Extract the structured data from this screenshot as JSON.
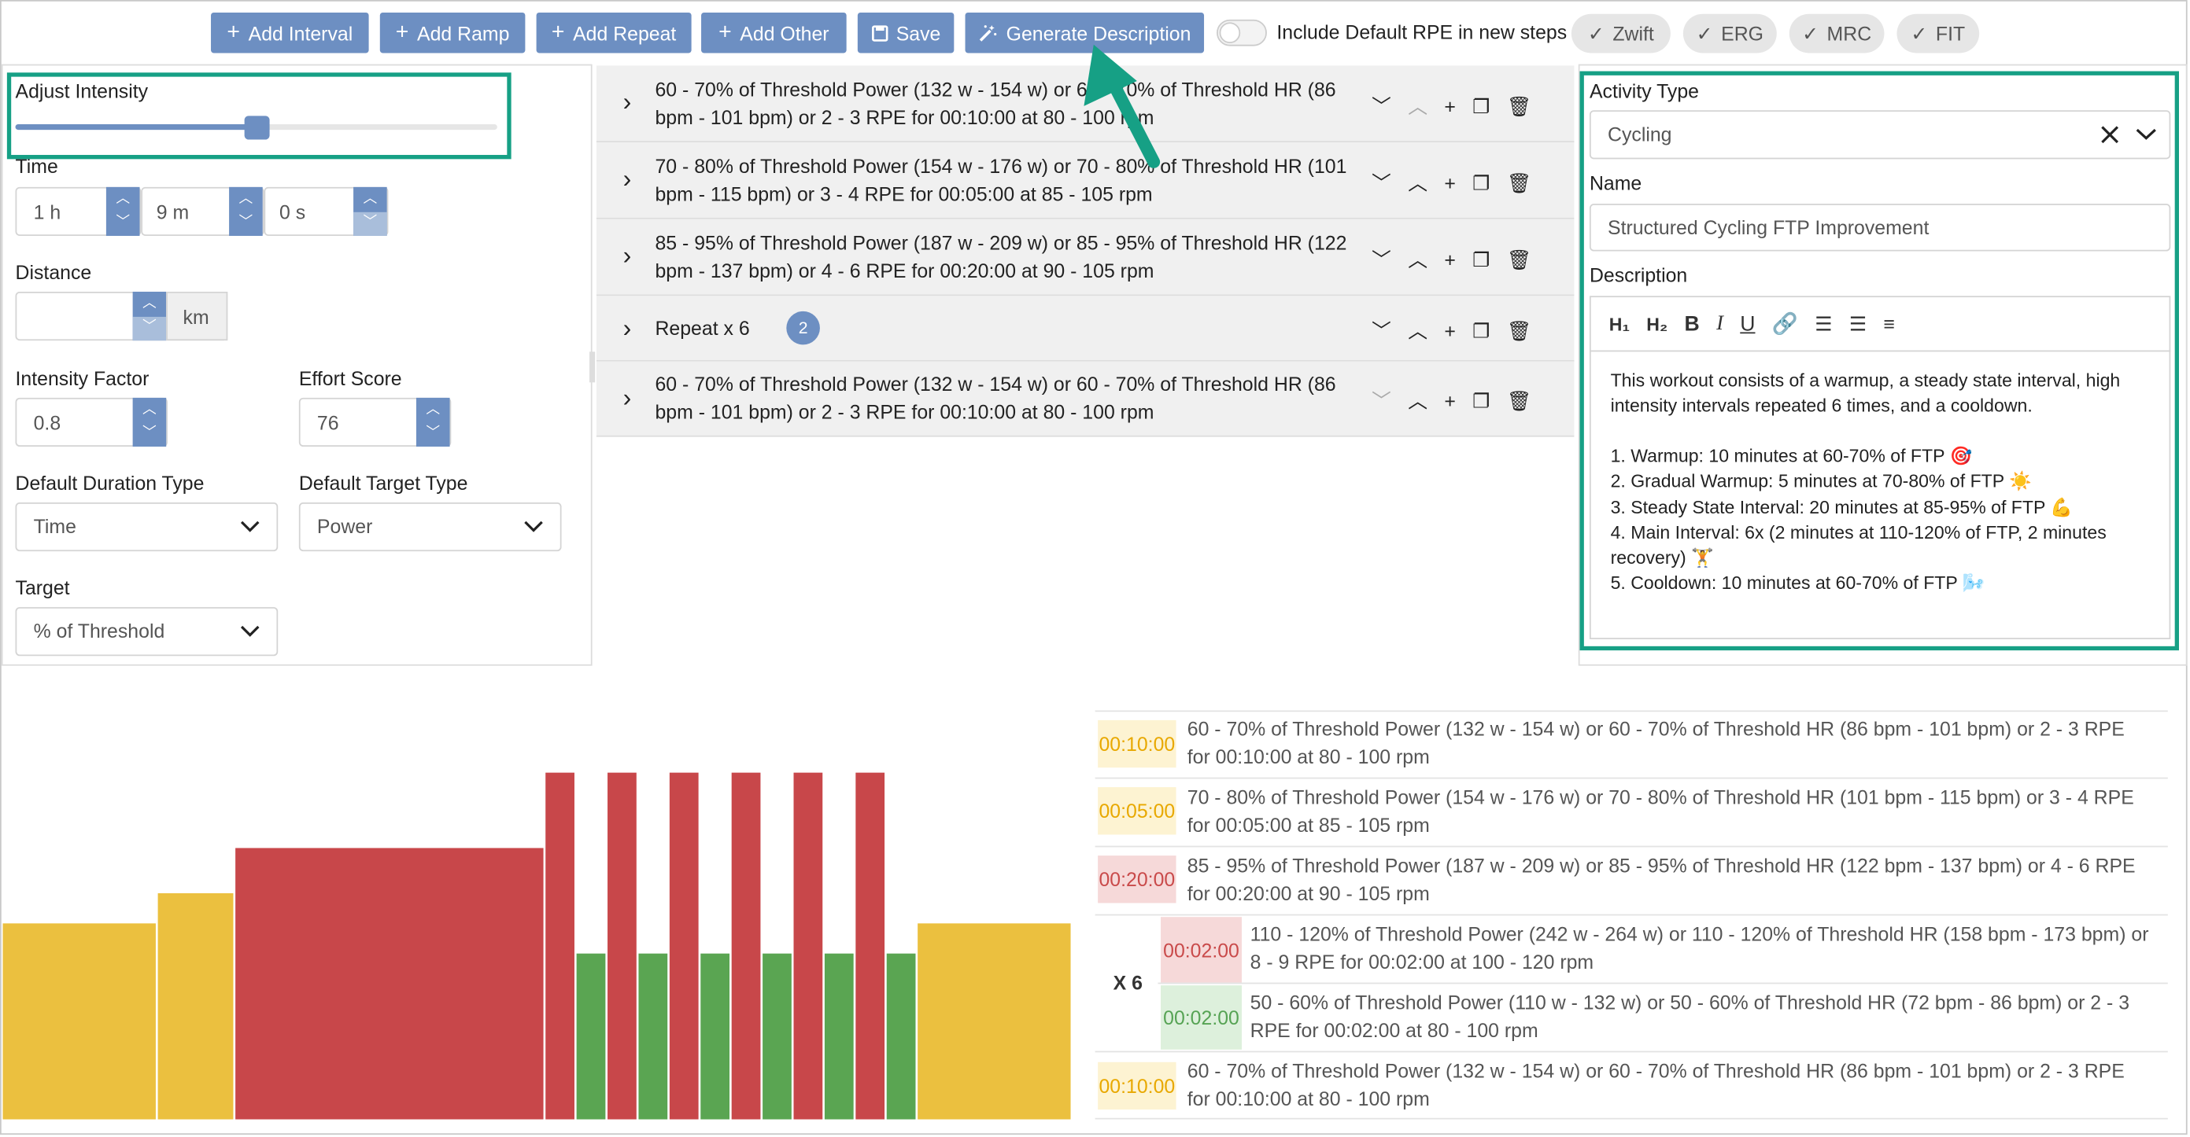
{
  "toolbar": {
    "add_interval": "Add Interval",
    "add_ramp": "Add Ramp",
    "add_repeat": "Add Repeat",
    "add_other": "Add Other",
    "save": "Save",
    "generate_description": "Generate Description",
    "rpe_toggle_label": "Include Default RPE in new steps",
    "rpe_toggle_on": false,
    "exports": [
      "Zwift",
      "ERG",
      "MRC",
      "FIT"
    ]
  },
  "left_panel": {
    "adjust_intensity_label": "Adjust Intensity",
    "intensity_slider_value": 0.5,
    "time_label": "Time",
    "time_hours": "1 h",
    "time_minutes": "9 m",
    "time_seconds": "0 s",
    "distance_label": "Distance",
    "distance_value": "",
    "distance_unit": "km",
    "intensity_factor_label": "Intensity Factor",
    "intensity_factor_value": "0.8",
    "effort_score_label": "Effort Score",
    "effort_score_value": "76",
    "duration_type_label": "Default Duration Type",
    "duration_type_value": "Time",
    "target_type_label": "Default Target Type",
    "target_type_value": "Power",
    "target_label": "Target",
    "target_value": "% of Threshold"
  },
  "steps": [
    {
      "text": "60 - 70% of Threshold Power (132 w - 154 w) or 60 - 70% of Threshold HR (86 bpm - 101 bpm) or 2 - 3 RPE for 00:10:00 at 80 - 100 rpm"
    },
    {
      "text": "70 - 80% of Threshold Power (154 w - 176 w) or 70 - 80% of Threshold HR (101 bpm - 115 bpm) or 3 - 4 RPE for 00:05:00 at 85 - 105 rpm"
    },
    {
      "text": "85 - 95% of Threshold Power (187 w - 209 w) or 85 - 95% of Threshold HR (122 bpm - 137 bpm) or 4 - 6 RPE for 00:20:00 at 90 - 105 rpm"
    },
    {
      "text": "Repeat x 6",
      "badge": "2"
    },
    {
      "text": "60 - 70% of Threshold Power (132 w - 154 w) or 60 - 70% of Threshold HR (86 bpm - 101 bpm) or 2 - 3 RPE for 00:10:00 at 80 - 100 rpm"
    }
  ],
  "right_panel": {
    "activity_type_label": "Activity Type",
    "activity_type_value": "Cycling",
    "name_label": "Name",
    "name_value": "Structured Cycling FTP Improvement",
    "description_label": "Description",
    "editor_tools": [
      "H1",
      "H2",
      "B",
      "I",
      "U",
      "link",
      "ordered-list",
      "bullet-list",
      "align"
    ],
    "description_intro": "This workout consists of a warmup, a steady state interval, high intensity intervals repeated 6 times, and a cooldown.",
    "description_items": [
      "1. Warmup: 10 minutes at 60-70% of FTP 🎯",
      "2. Gradual Warmup: 5 minutes at 70-80% of FTP ☀️",
      "3. Steady State Interval: 20 minutes at 85-95% of FTP 💪",
      "4. Main Interval: 6x (2 minutes at 110-120% of FTP, 2 minutes recovery) 🏋️",
      "5. Cooldown: 10 minutes at 60-70% of FTP 🌬️"
    ]
  },
  "summary": {
    "repeat_label": "X 6",
    "rows": [
      {
        "duration": "00:10:00",
        "zone": "yellow",
        "text": "60 - 70% of Threshold Power (132 w - 154 w) or 60 - 70% of Threshold HR (86 bpm - 101 bpm) or 2 - 3 RPE for 00:10:00 at 80 - 100 rpm"
      },
      {
        "duration": "00:05:00",
        "zone": "yellow",
        "text": "70 - 80% of Threshold Power (154 w - 176 w) or 70 - 80% of Threshold HR (101 bpm - 115 bpm) or 3 - 4 RPE for 00:05:00 at 85 - 105 rpm"
      },
      {
        "duration": "00:20:00",
        "zone": "red",
        "text": "85 - 95% of Threshold Power (187 w - 209 w) or 85 - 95% of Threshold HR (122 bpm - 137 bpm) or 4 - 6 RPE for 00:20:00 at 90 - 105 rpm"
      },
      {
        "duration": "00:02:00",
        "zone": "red",
        "text": "110 - 120% of Threshold Power (242 w - 264 w) or 110 - 120% of Threshold HR (158 bpm - 173 bpm) or 8 - 9 RPE for 00:02:00 at 100 - 120 rpm"
      },
      {
        "duration": "00:02:00",
        "zone": "green",
        "text": "50 - 60% of Threshold Power (110 w - 132 w) or 50 - 60% of Threshold HR (72 bpm - 86 bpm) or 2 - 3 RPE for 00:02:00 at 80 - 100 rpm"
      },
      {
        "duration": "00:10:00",
        "zone": "yellow",
        "text": "60 - 70% of Threshold Power (132 w - 154 w) or 60 - 70% of Threshold HR (86 bpm - 101 bpm) or 2 - 3 RPE for 00:10:00 at 80 - 100 rpm"
      }
    ]
  },
  "chart_data": {
    "type": "bar",
    "colors": {
      "yellow": "#ebc03f",
      "red": "#c8474a",
      "green": "#5aa552"
    },
    "segments": [
      {
        "duration_min": 10,
        "intensity_pct": 65,
        "zone": "yellow"
      },
      {
        "duration_min": 5,
        "intensity_pct": 75,
        "zone": "yellow"
      },
      {
        "duration_min": 20,
        "intensity_pct": 90,
        "zone": "red"
      },
      {
        "duration_min": 2,
        "intensity_pct": 115,
        "zone": "red"
      },
      {
        "duration_min": 2,
        "intensity_pct": 55,
        "zone": "green"
      },
      {
        "duration_min": 2,
        "intensity_pct": 115,
        "zone": "red"
      },
      {
        "duration_min": 2,
        "intensity_pct": 55,
        "zone": "green"
      },
      {
        "duration_min": 2,
        "intensity_pct": 115,
        "zone": "red"
      },
      {
        "duration_min": 2,
        "intensity_pct": 55,
        "zone": "green"
      },
      {
        "duration_min": 2,
        "intensity_pct": 115,
        "zone": "red"
      },
      {
        "duration_min": 2,
        "intensity_pct": 55,
        "zone": "green"
      },
      {
        "duration_min": 2,
        "intensity_pct": 115,
        "zone": "red"
      },
      {
        "duration_min": 2,
        "intensity_pct": 55,
        "zone": "green"
      },
      {
        "duration_min": 2,
        "intensity_pct": 115,
        "zone": "red"
      },
      {
        "duration_min": 2,
        "intensity_pct": 55,
        "zone": "green"
      },
      {
        "duration_min": 10,
        "intensity_pct": 65,
        "zone": "yellow"
      }
    ]
  }
}
